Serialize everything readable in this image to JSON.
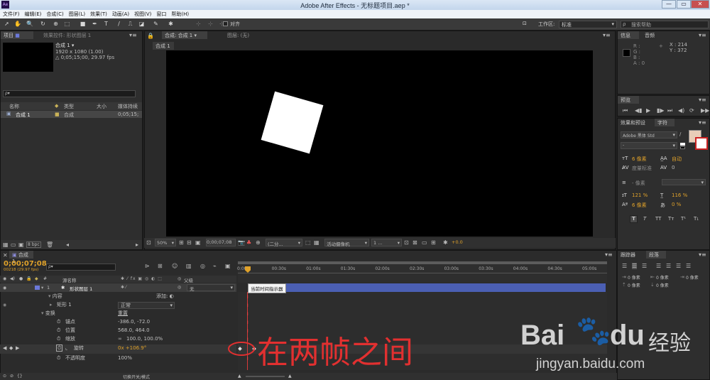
{
  "window": {
    "title": "Adobe After Effects - 无标题项目.aep *",
    "app_icon": "Ae",
    "min": "—",
    "max": "▭",
    "close": "✕"
  },
  "menu": [
    "文件(F)",
    "编辑(E)",
    "合成(C)",
    "图层(L)",
    "效果(T)",
    "动画(A)",
    "视图(V)",
    "窗口",
    "帮助(H)"
  ],
  "toolbar": {
    "align_label": "对齐",
    "workspace_label": "工作区:",
    "workspace_value": "标准",
    "search_placeholder": "搜索帮助"
  },
  "project_panel": {
    "tab_project": "项目",
    "tab_effects": "效果控件: 形状图层 1",
    "comp_name": "合成 1 ▾",
    "comp_size": "1920 x 1080 (1.00)",
    "comp_duration": "△ 0;05;15;00, 29.97 fps",
    "search_placeholder": "ρ▾",
    "columns": [
      "名称",
      "类型",
      "大小",
      "媒体持续"
    ],
    "items": [
      {
        "name": "合成 1",
        "type": "合成",
        "duration": "0;05;15;"
      }
    ],
    "bpc": "8 bpc"
  },
  "comp_viewer": {
    "tab": "合成: 合成 1",
    "tab_layer": "图层: (无)",
    "subtab": "合成 1",
    "zoom": "50%",
    "timecode": "0;00;07;08",
    "resolution": "(二分...",
    "camera": "活动摄像机",
    "views": "1 ...",
    "exposure": "+0.0"
  },
  "info_panel": {
    "tab_info": "信息",
    "tab_audio": "音频",
    "r": "R :",
    "g": "G :",
    "b": "B :",
    "a": "A : 0",
    "x": "X : 214",
    "y": "Y : 372"
  },
  "preview_panel": {
    "tab": "预览"
  },
  "char_panel": {
    "tab_effects": "效果和预设",
    "tab_char": "字符",
    "font": "Adobe 黑体 Std",
    "style": "-",
    "size": "6 像素",
    "leading": "自动",
    "tracking_label": "度量标准",
    "tracking_value": "0",
    "stroke": "- 像素",
    "vscale": "121 %",
    "hscale": "116 %",
    "baseline": "6 像素",
    "tsume": "0 %",
    "styles": [
      "T",
      "T",
      "TT",
      "Tт",
      "T¹",
      "T₁"
    ]
  },
  "tracker_panel": {
    "tab_tracker": "跟踪器",
    "tab_paragraph": "段落",
    "values": [
      "0 像素",
      "0 像素",
      "0 像素",
      "0 像素",
      "0 像素"
    ]
  },
  "timeline": {
    "tab": "合成 1",
    "timecode": "0;00;07;08",
    "fps": "00218 (29.97 fps)",
    "search_placeholder": "ρ▾",
    "col_source": "源名称",
    "col_parent": "父级",
    "layer": {
      "num": "1",
      "name": "形状图层 1",
      "parent": "无"
    },
    "props": [
      {
        "name": "内容",
        "value": "添加: ◐"
      },
      {
        "name": "矩形 1",
        "value": "正常"
      },
      {
        "name": "变换",
        "value": "重置"
      },
      {
        "name": "锚点",
        "value": "-386.0, -72.0"
      },
      {
        "name": "位置",
        "value": "568.0, 464.0"
      },
      {
        "name": "缩放",
        "value": "100.0, 100.0%"
      },
      {
        "name": "旋转",
        "value": "0x +106.9°"
      },
      {
        "name": "不透明度",
        "value": "100%"
      }
    ],
    "ruler": [
      "0:00s",
      "00:30s",
      "01:00s",
      "01:30s",
      "02:00s",
      "02:30s",
      "03:00s",
      "03:30s",
      "04:00s",
      "04:30s",
      "05:00s"
    ],
    "tooltip": "当前时间指示器",
    "footer": "切换开关/模式"
  },
  "annotation": "在两帧之间",
  "watermark": {
    "brand": "Bai",
    "brand2": "du",
    "suffix": "经验",
    "url": "jingyan.baidu.com"
  },
  "colors": {
    "accent_orange": "#e0a22a",
    "layer_bar": "#4b5fb3",
    "bg_dark": "#2e2e2e"
  }
}
